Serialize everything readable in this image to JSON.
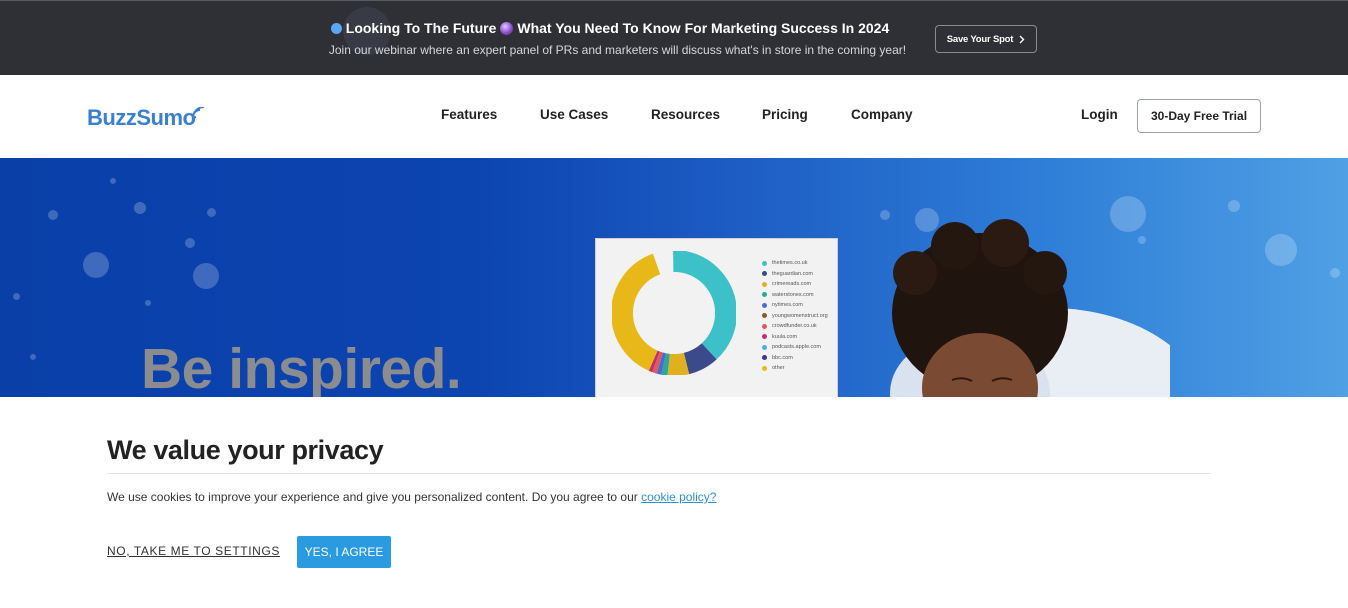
{
  "announcement": {
    "headline_part1": "Looking To The Future",
    "headline_part2": "What You Need To Know For Marketing Success In 2024",
    "subtext": "Join our webinar where an expert panel of PRs and marketers will discuss what's in store in the coming year!",
    "cta_label": "Save Your Spot",
    "cta_icon": "chevron-right-icon"
  },
  "header": {
    "logo_text": "BuzzSumo",
    "logo_icon": "signal-waves-icon",
    "nav": [
      "Features",
      "Use Cases",
      "Resources",
      "Pricing",
      "Company"
    ],
    "login_label": "Login",
    "trial_label": "30-Day Free Trial"
  },
  "hero": {
    "title": "Be inspired.",
    "chart_legend": [
      {
        "label": "thetimes.co.uk",
        "color": "#3cc1c8"
      },
      {
        "label": "theguardian.com",
        "color": "#3a4a8a"
      },
      {
        "label": "crimereads.com",
        "color": "#e0b020"
      },
      {
        "label": "waterstones.com",
        "color": "#2aa8a0"
      },
      {
        "label": "nytimes.com",
        "color": "#4a6ad0"
      },
      {
        "label": "youngwomenstruct.org",
        "color": "#8a5a2a"
      },
      {
        "label": "crowdfunder.co.uk",
        "color": "#e05a5a"
      },
      {
        "label": "kuula.com",
        "color": "#c0306a"
      },
      {
        "label": "podcasts.apple.com",
        "color": "#4ab0e0"
      },
      {
        "label": "bbc.com",
        "color": "#3a3a8a"
      },
      {
        "label": "other",
        "color": "#e8b818"
      }
    ]
  },
  "cookie": {
    "title": "We value your privacy",
    "message": "We use cookies to improve your experience and give you personalized content. Do you agree to our ",
    "policy_link": "cookie policy?",
    "settings_label": "NO, TAKE ME TO SETTINGS",
    "agree_label": "YES, I AGREE",
    "agree_color": "#2a9be0"
  }
}
